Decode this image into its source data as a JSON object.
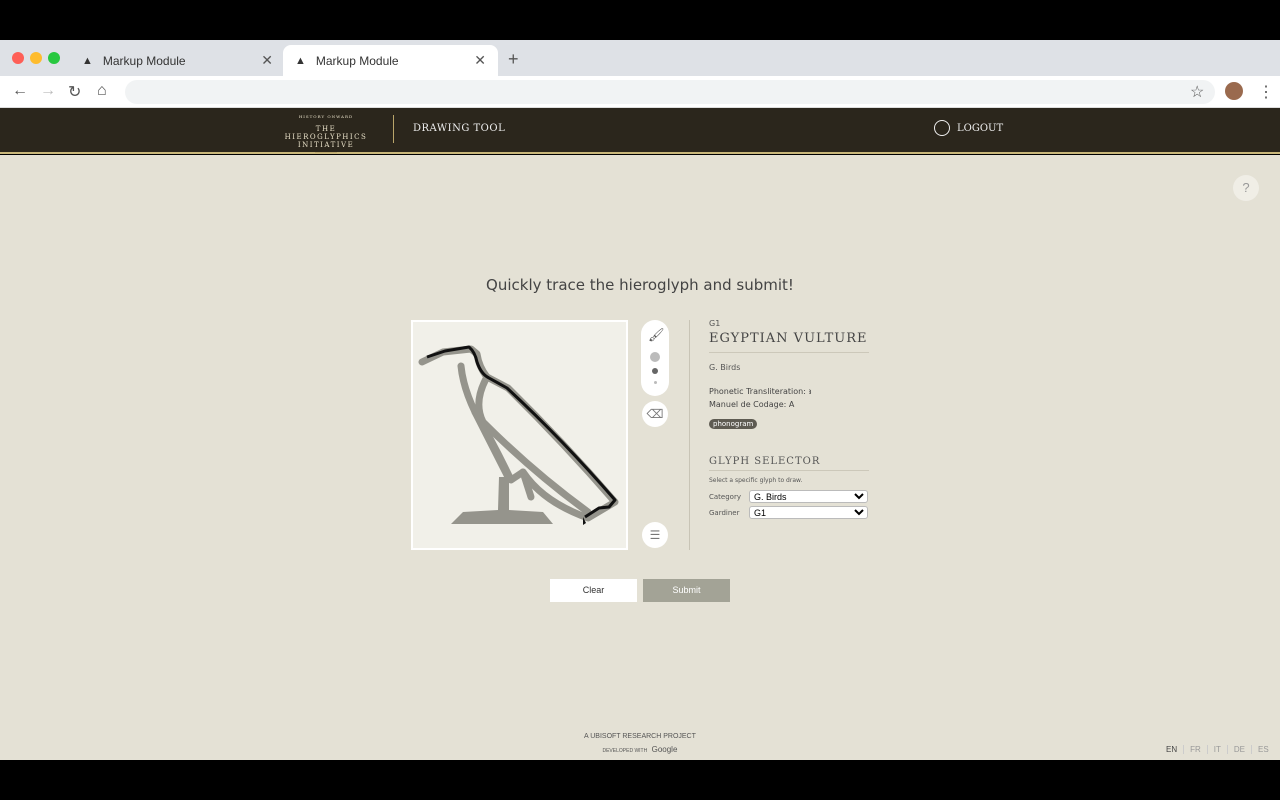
{
  "browser": {
    "tabs": [
      {
        "title": "Markup Module",
        "active": false
      },
      {
        "title": "Markup Module",
        "active": true
      }
    ],
    "url": ""
  },
  "header": {
    "logo_top": "HISTORY ONWARD",
    "logo_line1": "THE HIEROGLYPHICS",
    "logo_line2": "INITIATIVE",
    "section": "DRAWING TOOL",
    "logout": "LOGOUT"
  },
  "main": {
    "help": "?",
    "instruction": "Quickly trace the hieroglyph and submit!"
  },
  "glyph": {
    "code": "G1",
    "name": "EGYPTIAN VULTURE",
    "category": "G. Birds",
    "phonetic": "Phonetic Transliteration: ꜣ",
    "mdc": "Manuel de Codage: A",
    "tag": "phonogram"
  },
  "selector": {
    "heading": "GLYPH SELECTOR",
    "description": "Select a specific glyph to draw.",
    "category_label": "Category",
    "category_value": "G. Birds",
    "gardiner_label": "Gardiner",
    "gardiner_value": "G1"
  },
  "buttons": {
    "clear": "Clear",
    "submit": "Submit"
  },
  "footer": {
    "ubisoft": "A  UBISOFT RESEARCH PROJECT",
    "developed": "DEVELOPED WITH",
    "google": "Google"
  },
  "languages": [
    "EN",
    "FR",
    "IT",
    "DE",
    "ES"
  ],
  "colors": {
    "header": "#2b261c",
    "accent": "#c9b77a",
    "background": "#e4e1d5",
    "submit": "#a3a396"
  }
}
